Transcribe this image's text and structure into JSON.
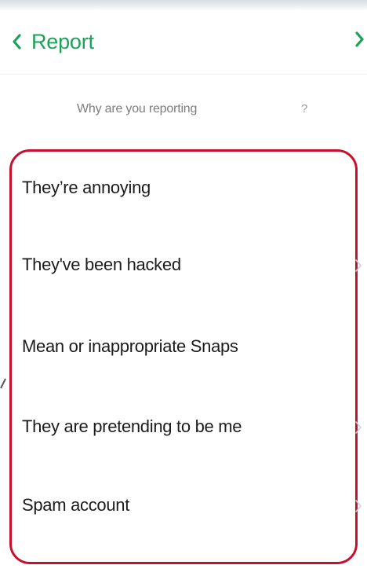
{
  "header": {
    "back_label": "Report"
  },
  "question": {
    "text": "Why are you reporting",
    "mark": "?"
  },
  "options": [
    {
      "label": "They’re annoying",
      "has_chevron": false
    },
    {
      "label": "They've been hacked",
      "has_chevron": true
    },
    {
      "label": "Mean or inappropriate Snaps",
      "has_chevron": false
    },
    {
      "label": "They are pretending to be me",
      "has_chevron": true
    },
    {
      "label": "Spam account",
      "has_chevron": true
    }
  ],
  "colors": {
    "accent": "#1da15a",
    "highlight_border": "#c8102e",
    "option_text": "#1c1c1c",
    "muted_text": "#7d7d7d"
  },
  "icons": {
    "back": "chevron-left-icon",
    "forward": "chevron-right-icon",
    "option_disclosure": "chevron-right-icon"
  }
}
